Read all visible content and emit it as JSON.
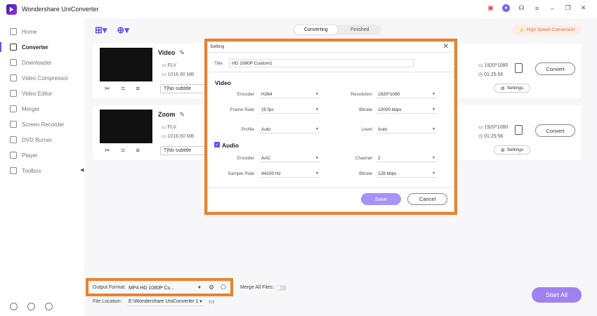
{
  "app": {
    "title": "Wondershare UniConverter"
  },
  "sidebar": {
    "items": [
      {
        "label": "Home",
        "icon": "home-icon"
      },
      {
        "label": "Converter",
        "icon": "converter-icon",
        "active": true
      },
      {
        "label": "Downloader",
        "icon": "download-icon"
      },
      {
        "label": "Video Compressor",
        "icon": "compress-icon"
      },
      {
        "label": "Video Editor",
        "icon": "scissors-icon"
      },
      {
        "label": "Merger",
        "icon": "merge-icon"
      },
      {
        "label": "Screen Recorder",
        "icon": "record-icon"
      },
      {
        "label": "DVD Burner",
        "icon": "disc-icon"
      },
      {
        "label": "Player",
        "icon": "play-icon"
      },
      {
        "label": "Toolbox",
        "icon": "grid-icon"
      }
    ]
  },
  "tabs": {
    "converting": "Converting",
    "finished": "Finished"
  },
  "high_speed": "High Speed Conversion",
  "files": [
    {
      "name": "Video",
      "format": "FLV",
      "size": "1016.60 MB",
      "subtitle": "No subtitle",
      "resolution": "1920*1080",
      "duration": "01:25:56",
      "convert": "Convert",
      "settings": "Settings"
    },
    {
      "name": "Zoom",
      "format": "FLV",
      "size": "1016.60 MB",
      "subtitle": "No subtitle",
      "resolution": "1920*1080",
      "duration": "01:25:56",
      "convert": "Convert",
      "settings": "Settings"
    }
  ],
  "dialog": {
    "title": "Setting",
    "title_label": "Title",
    "title_value": "HD 1080P Custom1",
    "video_section": "Video",
    "video": {
      "encoder_label": "Encoder",
      "encoder": "H264",
      "resolution_label": "Resolution",
      "resolution": "1920*1080",
      "framerate_label": "Frame Rate",
      "framerate": "25 fps",
      "bitrate_label": "Bitrate",
      "bitrate": "10000 kbps",
      "profile_label": "Profile",
      "profile": "Auto",
      "level_label": "Level",
      "level": "Auto"
    },
    "audio_section": "Audio",
    "audio": {
      "encoder_label": "Encoder",
      "encoder": "AAC",
      "channel_label": "Channel",
      "channel": "2",
      "samplerate_label": "Sample Rate",
      "samplerate": "44100 Hz",
      "bitrate_label": "Bitrate",
      "bitrate": "128 kbps"
    },
    "save": "Save",
    "cancel": "Cancel"
  },
  "bottom": {
    "output_label": "Output Format:",
    "output_value": "MP4 HD 1080P Cu...",
    "merge_label": "Merge All Files:",
    "location_label": "File Location:",
    "location_value": "E:\\Wondershare UniConverter 1",
    "start_all": "Start All"
  },
  "colors": {
    "accent": "#6b4ef6",
    "highlight": "#e98230"
  }
}
